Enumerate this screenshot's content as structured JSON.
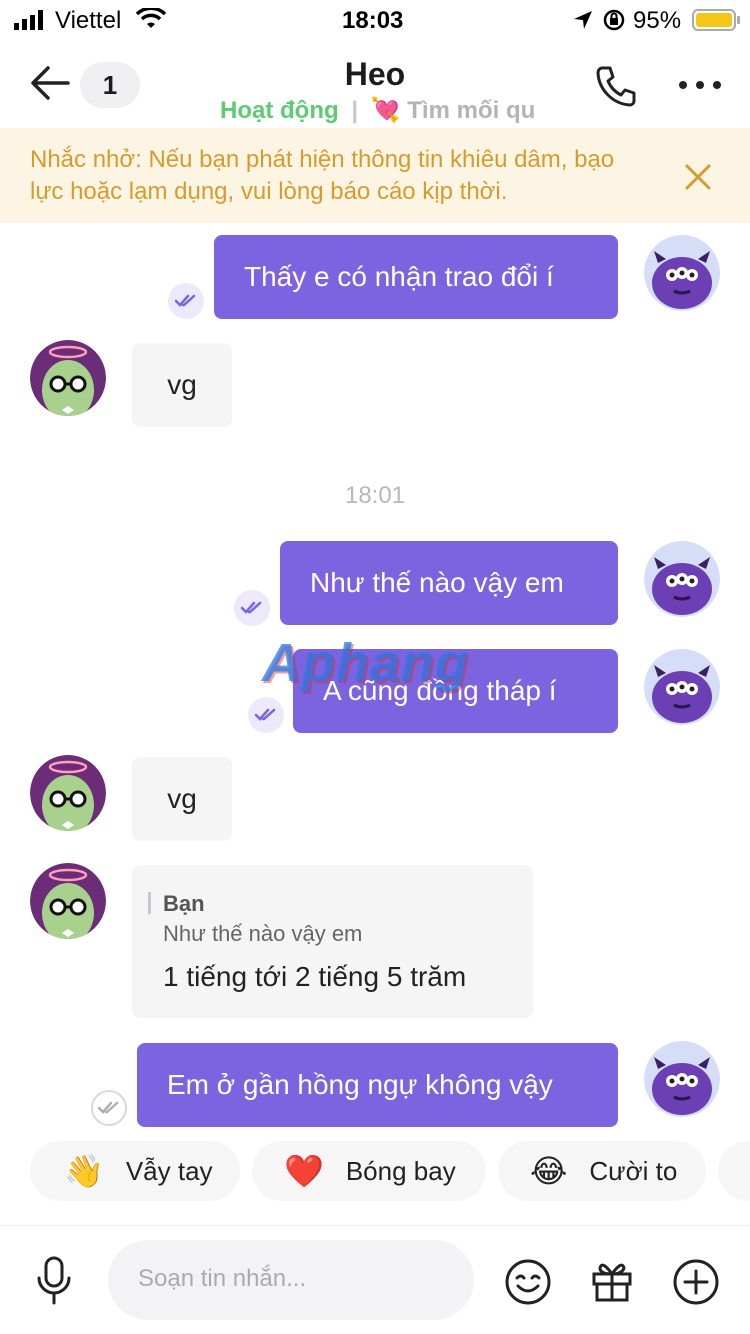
{
  "status_bar": {
    "carrier": "Viettel",
    "time": "18:03",
    "battery": "95%"
  },
  "header": {
    "back_badge": "1",
    "title": "Heo",
    "status": "Hoạt động",
    "tag_text": "Tìm mối qu",
    "tag_icon": "💘"
  },
  "reminder": {
    "text": "Nhắc nhở: Nếu bạn phát hiện thông tin khiêu dâm, bạo lực hoặc lạm dụng, vui lòng báo cáo kịp thời."
  },
  "messages": {
    "m1": "Thấy e có nhận trao đổi í",
    "m2": "vg",
    "timestamp": "18:01",
    "m3": "Như thế nào vậy em",
    "m4": "A cũng đồng tháp í",
    "m5": "vg",
    "reply_quote_author": "Bạn",
    "reply_quote_text": "Như thế nào vậy em",
    "reply_text": "1 tiếng tới 2 tiếng 5 trăm",
    "m6": "Em ở gần hồng ngự không vậy"
  },
  "watermark": {
    "text": "Aphang"
  },
  "quick_replies": [
    {
      "emoji": "👋",
      "label": "Vẫy tay"
    },
    {
      "emoji": "❤️",
      "label": "Bóng bay"
    },
    {
      "emoji": "😂",
      "label": "Cười to"
    }
  ],
  "composer": {
    "placeholder": "Soạn tin nhắn..."
  },
  "colors": {
    "accent": "#7c63e0",
    "online": "#5ecb74",
    "warning": "#d79b2c"
  }
}
